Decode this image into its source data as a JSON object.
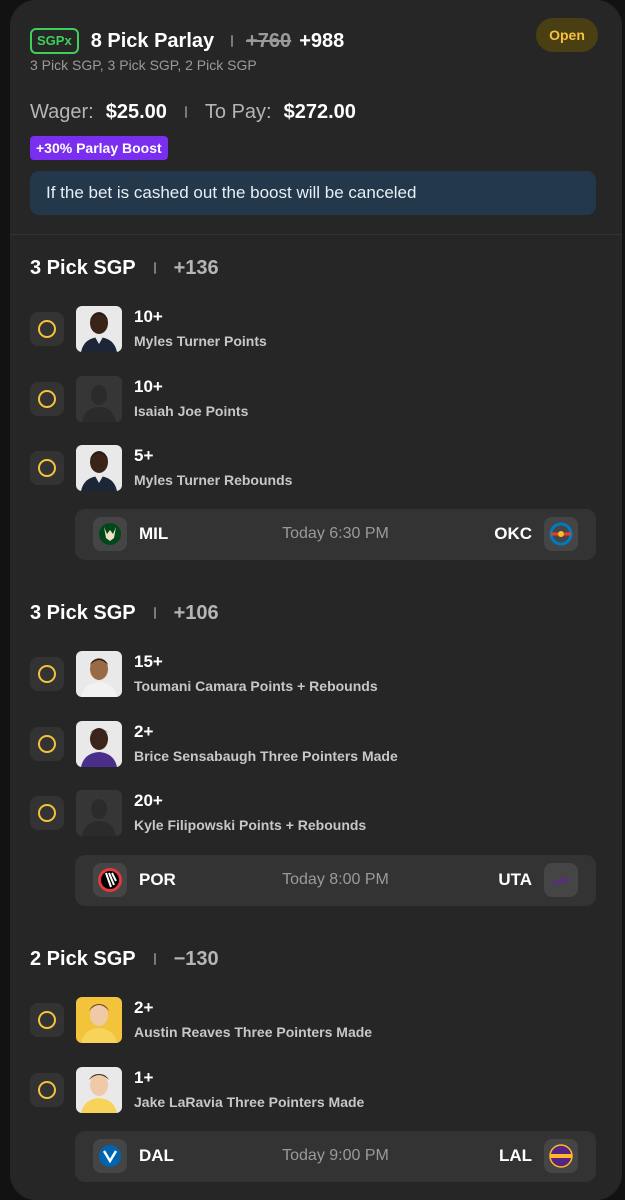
{
  "header": {
    "badge": "SGPx",
    "title": "8 Pick Parlay",
    "old_odds": "+760",
    "new_odds": "+988",
    "status": "Open",
    "subtitle": "3 Pick SGP, 3 Pick SGP, 2 Pick SGP"
  },
  "wager": {
    "wager_label": "Wager:",
    "wager_value": "$25.00",
    "pay_label": "To Pay:",
    "pay_value": "$272.00"
  },
  "boost": "+30% Parlay Boost",
  "notice": "If the bet is cashed out the boost will be canceled",
  "colors": {
    "accent_yellow": "#f4c23c",
    "boost_purple": "#7a2ff0",
    "sgpx_green": "#3ecf5b",
    "notice_bg": "#23384a"
  },
  "sections": [
    {
      "title": "3 Pick SGP",
      "odds": "+136",
      "legs": [
        {
          "line": "10+",
          "desc": "Myles Turner Points",
          "avatar": "player-photo"
        },
        {
          "line": "10+",
          "desc": "Isaiah Joe Points",
          "avatar": "placeholder"
        },
        {
          "line": "5+",
          "desc": "Myles Turner Rebounds",
          "avatar": "player-photo"
        }
      ],
      "game": {
        "home": "MIL",
        "away": "OKC",
        "time": "Today 6:30 PM",
        "home_logo": "bucks-logo-icon",
        "away_logo": "thunder-logo-icon"
      }
    },
    {
      "title": "3 Pick SGP",
      "odds": "+106",
      "legs": [
        {
          "line": "15+",
          "desc": "Toumani Camara Points + Rebounds",
          "avatar": "player-photo"
        },
        {
          "line": "2+",
          "desc": "Brice Sensabaugh Three Pointers Made",
          "avatar": "player-photo"
        },
        {
          "line": "20+",
          "desc": "Kyle Filipowski Points + Rebounds",
          "avatar": "placeholder"
        }
      ],
      "game": {
        "home": "POR",
        "away": "UTA",
        "time": "Today 8:00 PM",
        "home_logo": "blazers-logo-icon",
        "away_logo": "jazz-logo-icon"
      }
    },
    {
      "title": "2 Pick SGP",
      "odds": "−130",
      "legs": [
        {
          "line": "2+",
          "desc": "Austin Reaves Three Pointers Made",
          "avatar": "player-photo"
        },
        {
          "line": "1+",
          "desc": "Jake LaRavia Three Pointers Made",
          "avatar": "player-photo"
        }
      ],
      "game": {
        "home": "DAL",
        "away": "LAL",
        "time": "Today 9:00 PM",
        "home_logo": "mavericks-logo-icon",
        "away_logo": "lakers-logo-icon"
      }
    }
  ]
}
